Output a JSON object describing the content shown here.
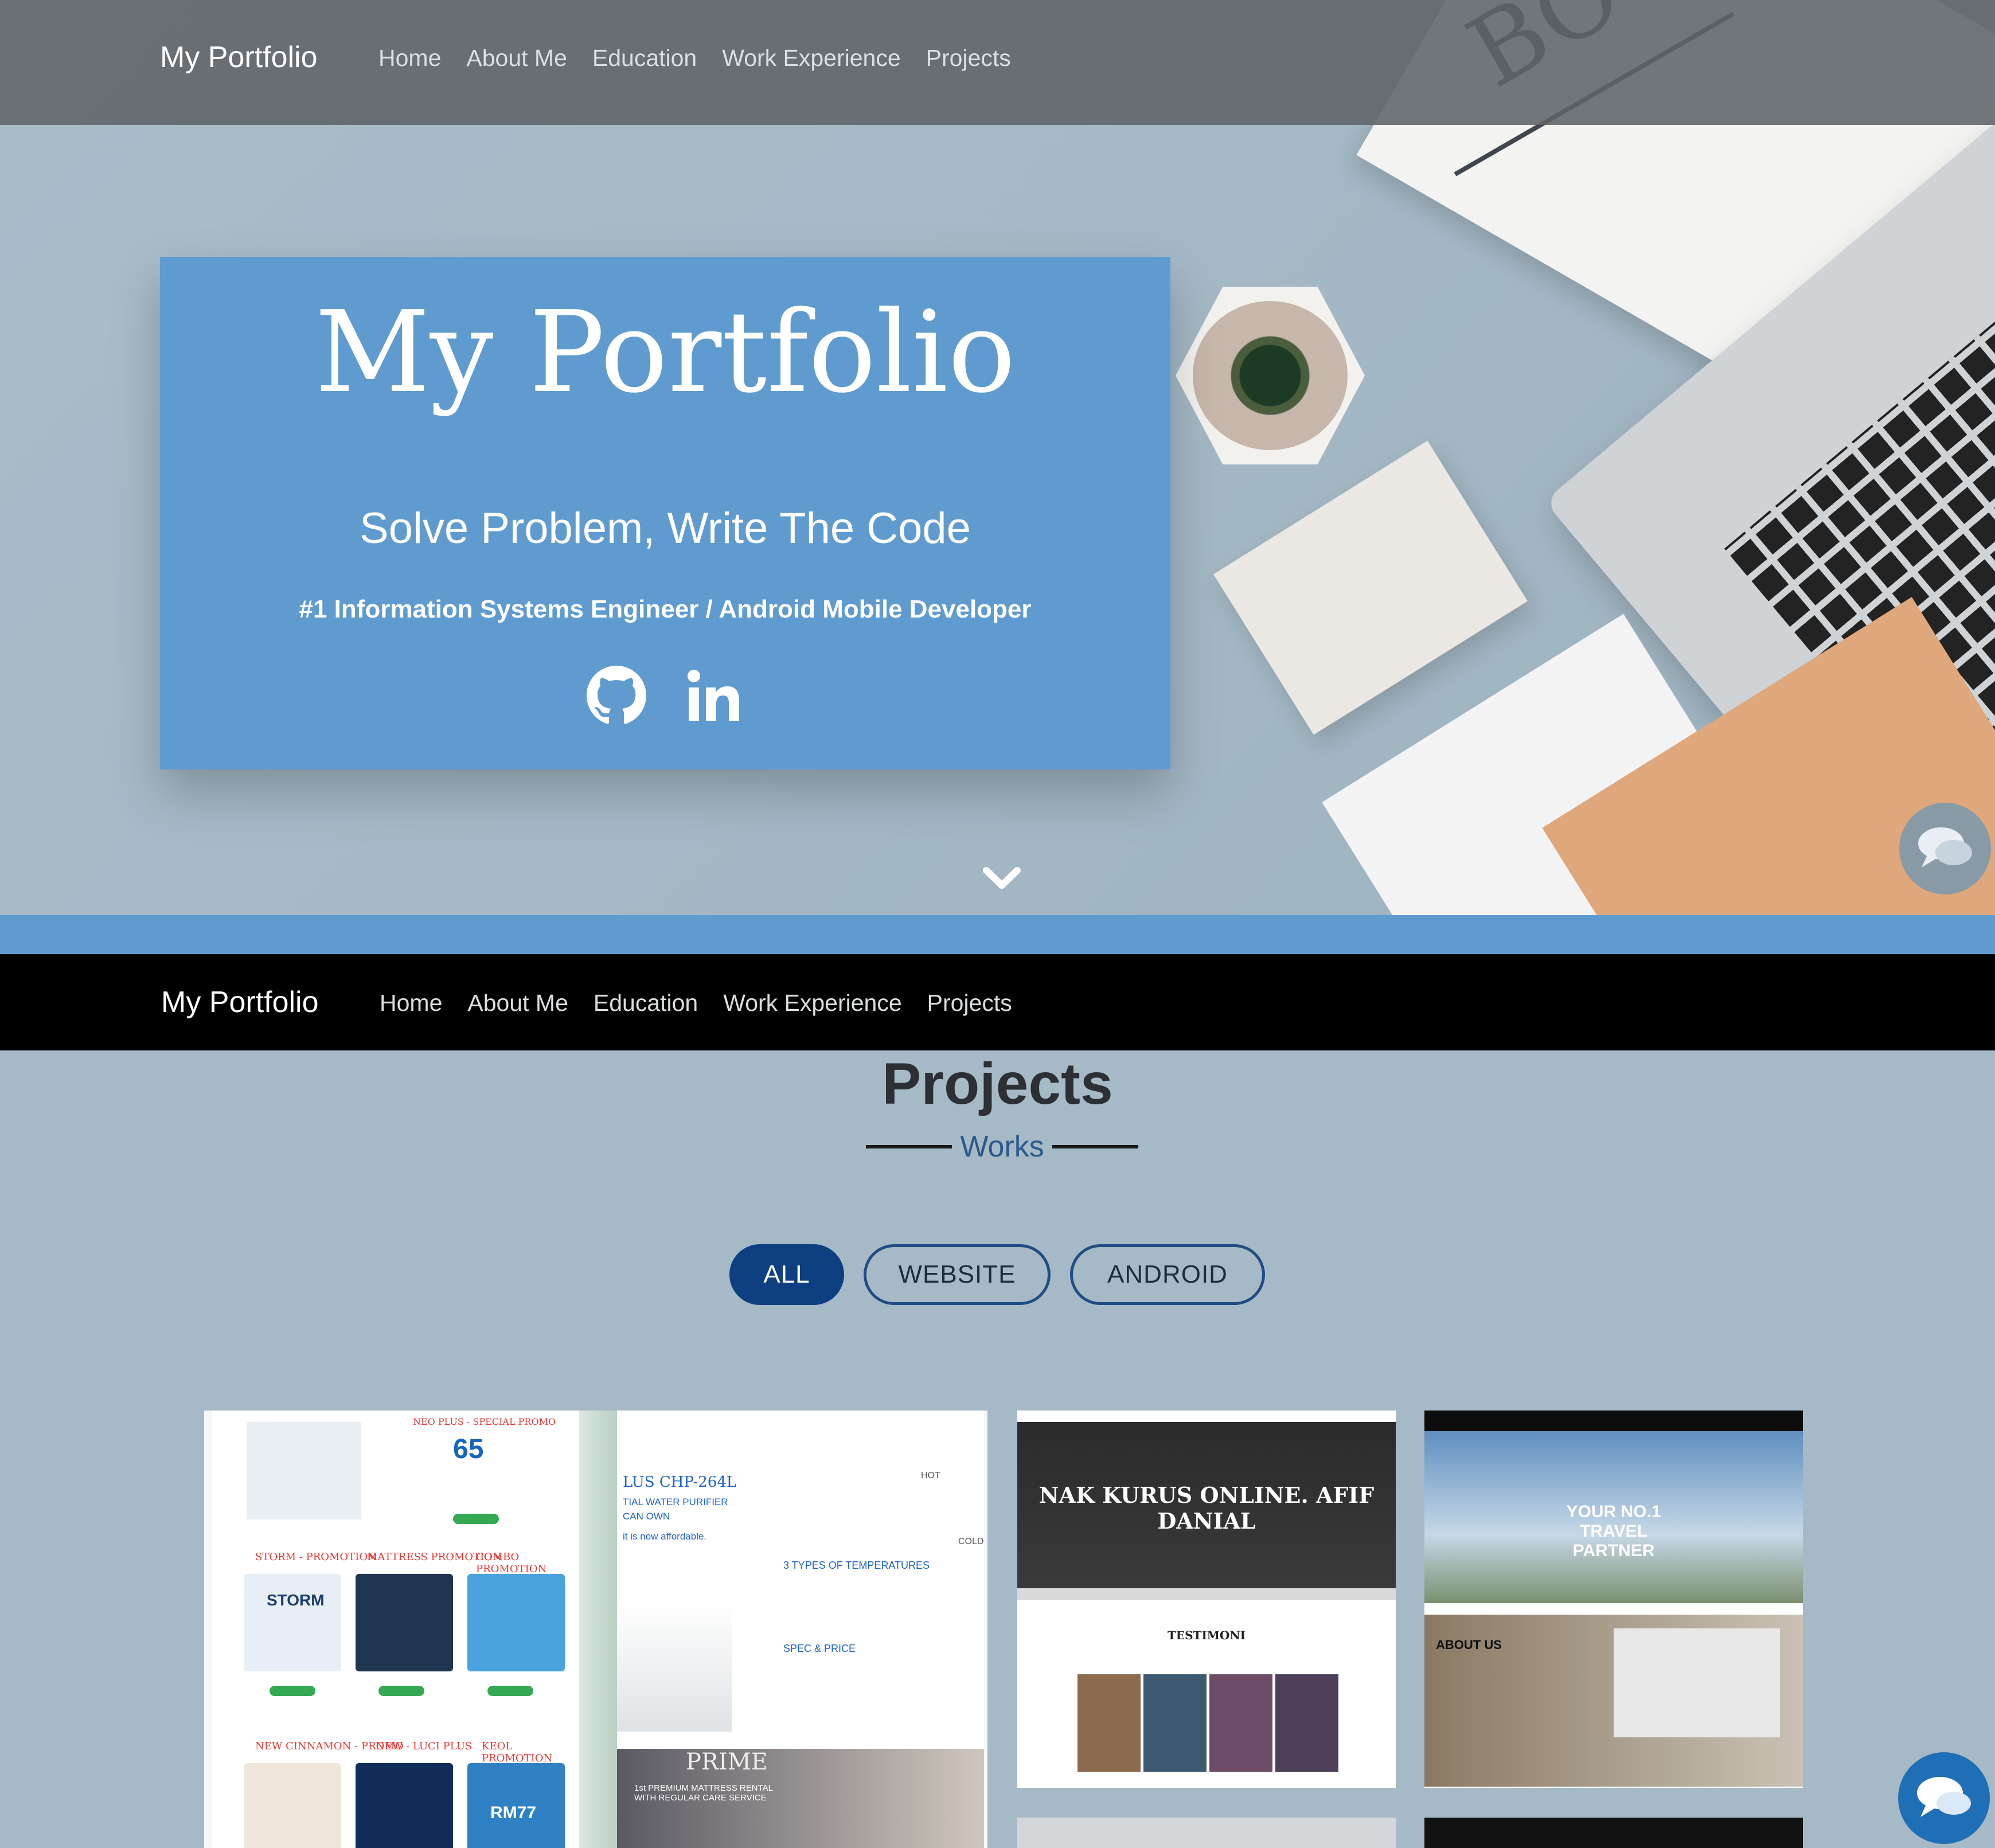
{
  "header": {
    "brand": "My Portfolio",
    "nav": [
      "Home",
      "About Me",
      "Education",
      "Work Experience",
      "Projects"
    ]
  },
  "hero": {
    "title": "My Portfolio",
    "subtitle": "Solve Problem, Write The Code",
    "role": "#1 Information Systems Engineer / Android Mobile Developer",
    "icons": [
      "github-icon",
      "linkedin-icon"
    ],
    "scroll_icon": "chevron-down-icon",
    "decor_book_text": "BO"
  },
  "sticky_nav": {
    "brand": "My Portfolio",
    "nav": [
      "Home",
      "About Me",
      "Education",
      "Work Experience",
      "Projects"
    ]
  },
  "projects": {
    "title": "Projects",
    "subtitle": "Works",
    "filters": [
      {
        "label": "ALL",
        "active": true
      },
      {
        "label": "WEBSITE",
        "active": false
      },
      {
        "label": "ANDROID",
        "active": false
      }
    ],
    "thumb1": {
      "promo_header": "NEO PLUS - SPECIAL PROMO",
      "price": "65",
      "labels": [
        "STORM - PROMOTION",
        "MATTRESS PROMOTION",
        "COMBO PROMOTION",
        "NEW CINNAMON - PROMO",
        "NEW - LUCI PLUS",
        "KEOL PROMOTION"
      ],
      "product_name": "LUS CHP-264L",
      "product_sub": "TIAL WATER PURIFIER",
      "can_own": "CAN OWN",
      "affordable": "it is now affordable.",
      "temps": "3 TYPES OF TEMPERATURES",
      "hot": "HOT",
      "cold": "COLD",
      "spec": "SPEC & PRICE",
      "prime": "PRIME",
      "prime_sub": "1st PREMIUM MATTRESS RENTAL WITH REGULAR CARE SERVICE",
      "storm": "STORM",
      "rm": "RM77"
    },
    "thumb2": {
      "headline": "NAK KURUS ONLINE. AFIF DANIAL",
      "section": "TESTIMONI"
    },
    "thumb3": {
      "headline": "YOUR NO.1 TRAVEL PARTNER",
      "section": "ABOUT US"
    }
  },
  "chat_icon": "chat-bubbles-icon",
  "colors": {
    "accent": "#5f9bcf",
    "filter_active": "#0e3f80",
    "page_bg": "#a6b9c6",
    "navbar_dark": "#000000"
  }
}
